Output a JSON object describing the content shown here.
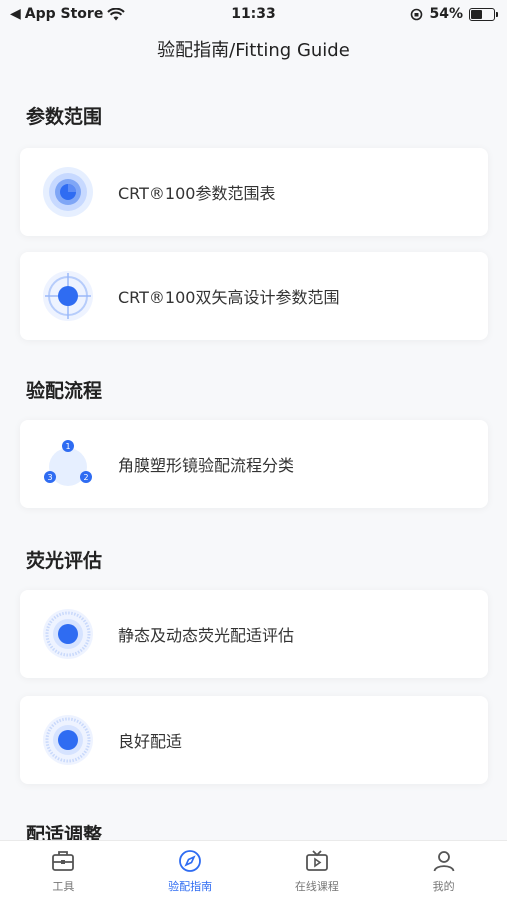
{
  "status_bar": {
    "back_label": "App Store",
    "time": "11:33",
    "battery": "54%",
    "battery_level": 0.54
  },
  "header": {
    "title": "验配指南/Fitting Guide"
  },
  "sections": [
    {
      "title": "参数范围",
      "items": [
        {
          "label": "CRT®100参数范围表",
          "icon": "target-icon"
        },
        {
          "label": "CRT®100双矢高设计参数范围",
          "icon": "crosshair-icon"
        }
      ]
    },
    {
      "title": "验配流程",
      "items": [
        {
          "label": "角膜塑形镜验配流程分类",
          "icon": "flow-steps-icon",
          "steps": [
            "1",
            "2",
            "3"
          ]
        }
      ]
    },
    {
      "title": "荧光评估",
      "items": [
        {
          "label": "静态及动态荧光配适评估",
          "icon": "fluorescein-icon"
        },
        {
          "label": "良好配适",
          "icon": "fluorescein-icon"
        }
      ]
    },
    {
      "title": "配适调整",
      "items": []
    }
  ],
  "tabbar": [
    {
      "label": "工具",
      "icon": "toolbox-icon"
    },
    {
      "label": "验配指南",
      "icon": "compass-icon",
      "active": true
    },
    {
      "label": "在线课程",
      "icon": "tv-icon"
    },
    {
      "label": "我的",
      "icon": "user-icon"
    }
  ],
  "colors": {
    "accent": "#2f6cf2",
    "background": "#f7f8fa"
  }
}
